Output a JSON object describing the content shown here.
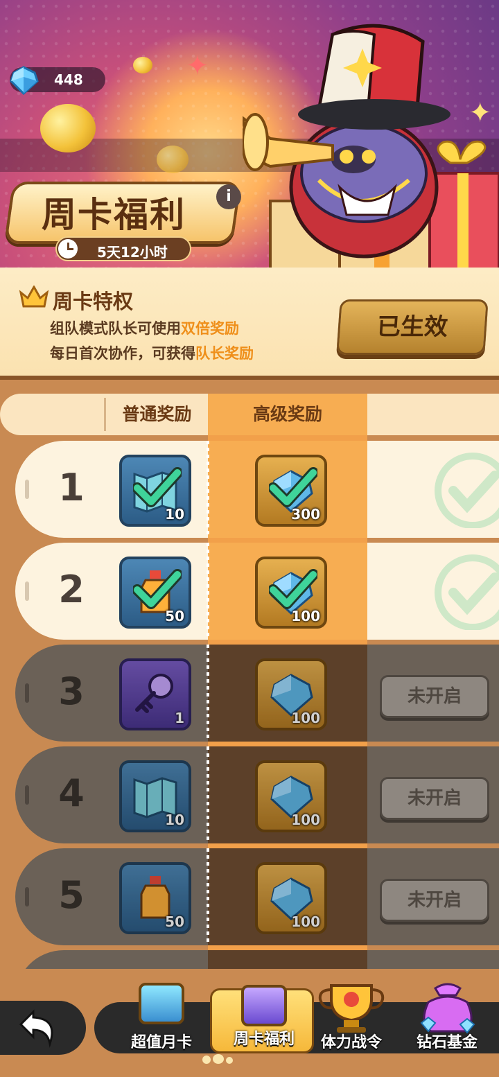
{
  "header": {
    "currency": {
      "icon": "diamond-icon",
      "amount": "448"
    },
    "title": "周卡福利",
    "info_icon": "info-icon",
    "timer": {
      "icon": "clock-icon",
      "text": "5天12小时"
    }
  },
  "privilege": {
    "title": "周卡特权",
    "line1_prefix": "组队模式队长可使用",
    "line1_highlight": "双倍奖励",
    "line2_prefix": "每日首次协作，可获得",
    "line2_highlight": "队长奖励",
    "status_button": "已生效"
  },
  "columns": {
    "normal": "普通奖励",
    "premium": "高级奖励"
  },
  "rows": [
    {
      "day": "1",
      "claimed": true,
      "normal": {
        "icon": "map-icon",
        "qty": "10"
      },
      "premium": {
        "icon": "diamond-icon",
        "qty": "300"
      }
    },
    {
      "day": "2",
      "claimed": true,
      "normal": {
        "icon": "potion-bottle-icon",
        "qty": "50"
      },
      "premium": {
        "icon": "diamond-icon",
        "qty": "100"
      }
    },
    {
      "day": "3",
      "claimed": false,
      "normal": {
        "icon": "key-icon",
        "qty": "1"
      },
      "premium": {
        "icon": "diamond-icon",
        "qty": "100"
      },
      "status": "未开启"
    },
    {
      "day": "4",
      "claimed": false,
      "normal": {
        "icon": "map-icon",
        "qty": "10"
      },
      "premium": {
        "icon": "diamond-icon",
        "qty": "100"
      },
      "status": "未开启"
    },
    {
      "day": "5",
      "claimed": false,
      "normal": {
        "icon": "potion-bottle-icon",
        "qty": "50"
      },
      "premium": {
        "icon": "diamond-icon",
        "qty": "100"
      },
      "status": "未开启"
    }
  ],
  "nav": {
    "back_icon": "back-arrow-icon",
    "items": [
      {
        "label": "超值月卡",
        "icon": "monthly-card-icon",
        "active": false
      },
      {
        "label": "周卡福利",
        "icon": "weekly-card-icon",
        "active": true
      },
      {
        "label": "体力战令",
        "icon": "trophy-icon",
        "active": false
      },
      {
        "label": "钻石基金",
        "icon": "diamond-bag-icon",
        "active": false
      }
    ]
  },
  "colors": {
    "accent_orange": "#f7ad52",
    "highlight_text": "#ef8f1a",
    "claimed_row": "#fdf3df",
    "locked_row": "#6b6157",
    "check_green": "#3fd49a"
  }
}
